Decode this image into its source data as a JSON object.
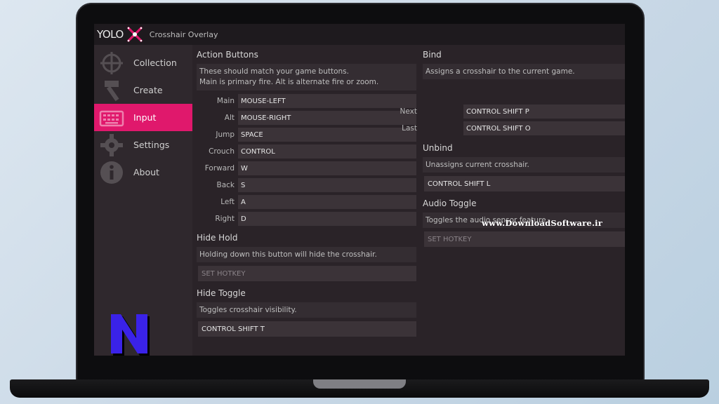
{
  "app": {
    "logo_text": "YOLO",
    "title": "Crosshair Overlay"
  },
  "sidebar": {
    "items": [
      {
        "label": "Collection",
        "icon": "crosshair-icon",
        "active": false
      },
      {
        "label": "Create",
        "icon": "hammer-icon",
        "active": false
      },
      {
        "label": "Input",
        "icon": "keyboard-icon",
        "active": true
      },
      {
        "label": "Settings",
        "icon": "gear-icon",
        "active": false
      },
      {
        "label": "About",
        "icon": "info-icon",
        "active": false
      }
    ]
  },
  "action_buttons": {
    "title": "Action Buttons",
    "description_line1": "These should match your game buttons.",
    "description_line2": "Main is primary fire. Alt is alternate fire or zoom.",
    "rows": [
      {
        "label": "Main",
        "value": "MOUSE-LEFT"
      },
      {
        "label": "Alt",
        "value": "MOUSE-RIGHT"
      },
      {
        "label": "Jump",
        "value": "SPACE"
      },
      {
        "label": "Crouch",
        "value": "CONTROL"
      },
      {
        "label": "Forward",
        "value": "W"
      },
      {
        "label": "Back",
        "value": "S"
      },
      {
        "label": "Left",
        "value": "A"
      },
      {
        "label": "Right",
        "value": "D"
      }
    ]
  },
  "hide_hold": {
    "title": "Hide Hold",
    "description": "Holding down this button will hide the crosshair.",
    "value": "SET HOTKEY"
  },
  "hide_toggle": {
    "title": "Hide Toggle",
    "description": "Toggles crosshair visibility.",
    "value": "CONTROL SHIFT T"
  },
  "bind": {
    "title": "Bind",
    "description": "Assigns a crosshair to the current game.",
    "rows": [
      {
        "label": "Next",
        "value": "CONTROL SHIFT P"
      },
      {
        "label": "Last",
        "value": "CONTROL SHIFT O"
      }
    ]
  },
  "unbind": {
    "title": "Unbind",
    "description": "Unassigns current crosshair.",
    "value": "CONTROL SHIFT L"
  },
  "audio_toggle": {
    "title": "Audio Toggle",
    "description": "Toggles the audio sensor feature.",
    "value": "SET HOTKEY"
  },
  "watermark": "www.DownloadSoftware.ir",
  "colors": {
    "accent": "#e0186c",
    "background": "#2a2328",
    "sidebar": "#2f282d",
    "field": "#3b3338"
  }
}
